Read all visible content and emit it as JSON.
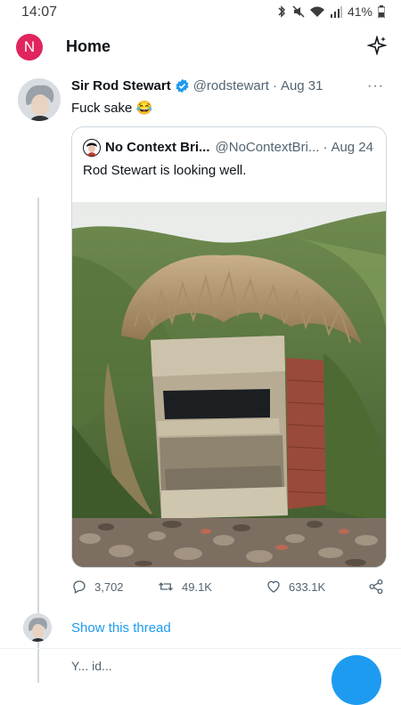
{
  "status_bar": {
    "time": "14:07",
    "battery": "41%",
    "icons": [
      "bluetooth-icon",
      "mute-icon",
      "wifi-icon",
      "signal-icon",
      "battery-icon"
    ]
  },
  "header": {
    "avatar_letter": "N",
    "title": "Home",
    "sparkle_icon": "sparkle-icon"
  },
  "tweet": {
    "author_name": "Sir Rod Stewart",
    "handle": "@rodstewart",
    "separator": "·",
    "date": "Aug 31",
    "more": "···",
    "text": "Fuck sake 😂",
    "quoted": {
      "name": "No Context Bri...",
      "handle": "@NoContextBri...",
      "separator": "·",
      "date": "Aug 24",
      "text": "Rod Stewart is looking well."
    },
    "actions": {
      "replies": "3,702",
      "retweets": "49.1K",
      "likes": "633.1K"
    }
  },
  "show_thread": "Show this thread",
  "next_tweet_preview": "Y... id...",
  "colors": {
    "accent": "#1d9bf0",
    "avatar_n": "#e0245e",
    "muted": "#536471"
  }
}
